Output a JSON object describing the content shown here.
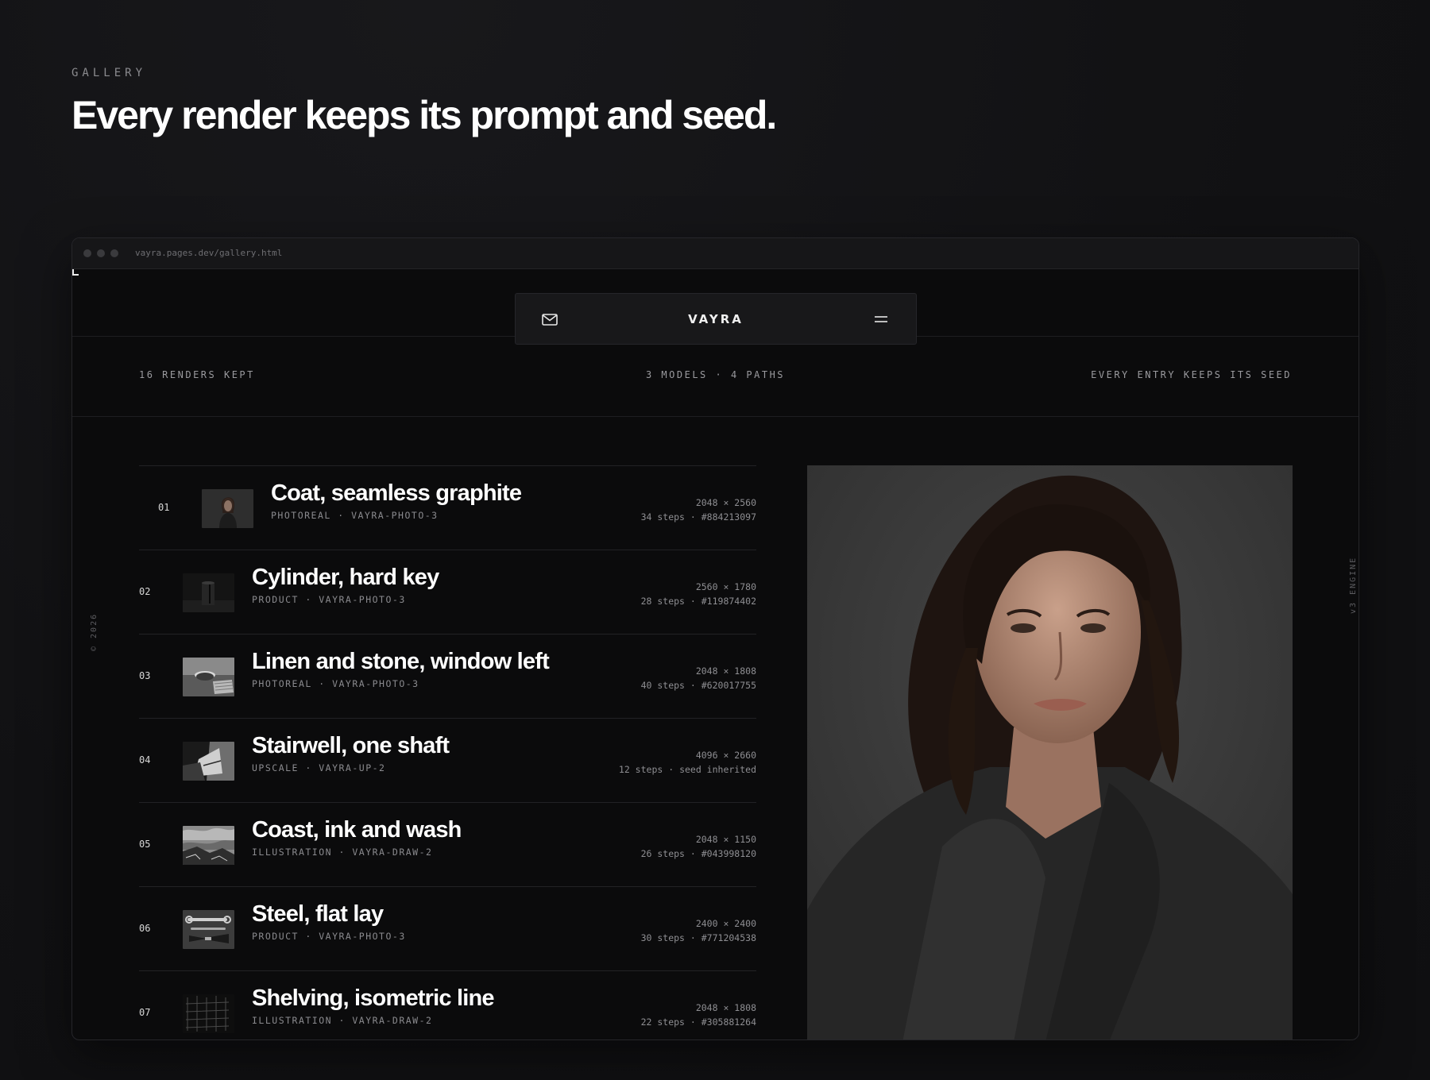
{
  "section": {
    "eyebrow": "GALLERY",
    "headline": "Every render keeps its prompt and seed."
  },
  "browser": {
    "url": "vayra.pages.dev/gallery.html"
  },
  "nav": {
    "brand": "VAYRA",
    "left_icon": "mail-icon",
    "right_icon": "menu-icon"
  },
  "stats": {
    "renders": "16 RENDERS KEPT",
    "models": "3 MODELS · 4 PATHS",
    "seed_note": "EVERY ENTRY KEEPS ITS SEED"
  },
  "side": {
    "left": "© 2026",
    "right": "v3 ENGINE"
  },
  "renders": [
    {
      "num": "01",
      "title": "Coat, seamless graphite",
      "sub": "PHOTOREAL · VAYRA-PHOTO-3",
      "dims": "2048 × 2560",
      "detail": "34 steps · #884213097"
    },
    {
      "num": "02",
      "title": "Cylinder, hard key",
      "sub": "PRODUCT · VAYRA-PHOTO-3",
      "dims": "2560 × 1780",
      "detail": "28 steps · #119874402"
    },
    {
      "num": "03",
      "title": "Linen and stone, window left",
      "sub": "PHOTOREAL · VAYRA-PHOTO-3",
      "dims": "2048 × 1808",
      "detail": "40 steps · #620017755"
    },
    {
      "num": "04",
      "title": "Stairwell, one shaft",
      "sub": "UPSCALE · VAYRA-UP-2",
      "dims": "4096 × 2660",
      "detail": "12 steps · seed inherited"
    },
    {
      "num": "05",
      "title": "Coast, ink and wash",
      "sub": "ILLUSTRATION · VAYRA-DRAW-2",
      "dims": "2048 × 1150",
      "detail": "26 steps · #043998120"
    },
    {
      "num": "06",
      "title": "Steel, flat lay",
      "sub": "PRODUCT · VAYRA-PHOTO-3",
      "dims": "2400 × 2400",
      "detail": "30 steps · #771204538"
    },
    {
      "num": "07",
      "title": "Shelving, isometric line",
      "sub": "ILLUSTRATION · VAYRA-DRAW-2",
      "dims": "2048 × 1808",
      "detail": "22 steps · #305881264"
    }
  ]
}
